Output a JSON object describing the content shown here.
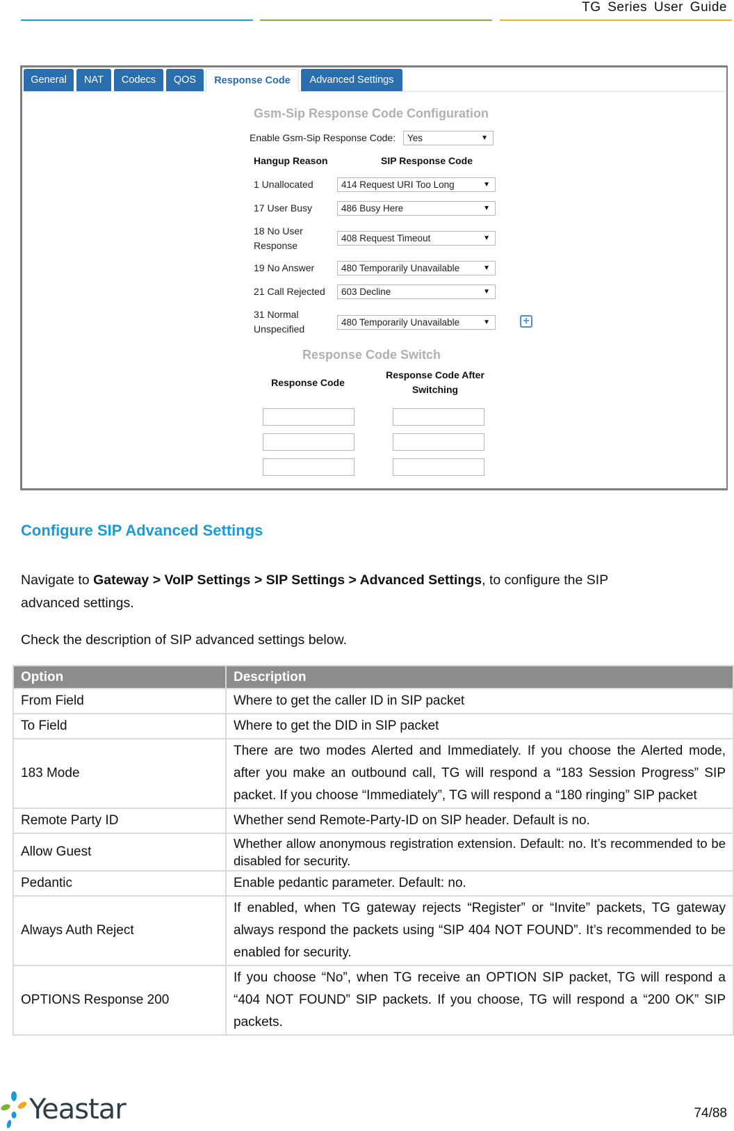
{
  "header": {
    "doc_title": "TG Series User Guide",
    "rule_colors": [
      "#1a9ad6",
      "#7db13a",
      "#f0b323"
    ]
  },
  "screenshot": {
    "tabs": [
      {
        "label": "General",
        "active": false
      },
      {
        "label": "NAT",
        "active": false
      },
      {
        "label": "Codecs",
        "active": false
      },
      {
        "label": "QOS",
        "active": false
      },
      {
        "label": "Response Code",
        "active": true
      },
      {
        "label": "Advanced Settings",
        "active": false
      }
    ],
    "config_title": "Gsm-Sip Response Code Configuration",
    "enable_label": "Enable Gsm-Sip Response Code:",
    "enable_value": "Yes",
    "col_hangup": "Hangup Reason",
    "col_sip": "SIP Response Code",
    "rows": [
      {
        "reason": "1 Unallocated",
        "code": "414 Request URI Too Long"
      },
      {
        "reason": "17 User Busy",
        "code": "486 Busy Here"
      },
      {
        "reason_line1": "18 No User",
        "reason_line2": "Response",
        "code": "408 Request Timeout"
      },
      {
        "reason": "19 No Answer",
        "code": "480 Temporarily Unavailable"
      },
      {
        "reason": "21 Call Rejected",
        "code": "603 Decline"
      },
      {
        "reason_line1": "31 Normal",
        "reason_line2": "Unspecified",
        "code": "480 Temporarily Unavailable"
      }
    ],
    "add_icon": "plus-square-icon",
    "switch_title": "Response Code Switch",
    "switch_col1": "Response Code",
    "switch_col2_line1": "Response Code After",
    "switch_col2_line2": "Switching",
    "switch_inputs": [
      {
        "from": "",
        "to": ""
      },
      {
        "from": "",
        "to": ""
      },
      {
        "from": "",
        "to": ""
      }
    ],
    "arrow_glyph": "▼",
    "accent": "#2a6ead"
  },
  "section": {
    "heading": "Configure SIP Advanced Settings",
    "nav_prefix": "Navigate to ",
    "nav_path": [
      "Gateway",
      "VoIP Settings",
      "SIP Settings",
      "Advanced Settings"
    ],
    "nav_sep": " > ",
    "nav_suffix": ", to configure the SIP",
    "nav_line2": "advanced settings.",
    "check_text": "Check the description of SIP advanced settings below."
  },
  "table": {
    "headers": [
      "Option",
      "Description"
    ],
    "rows": [
      {
        "option": "From Field",
        "description": "Where to get the caller ID in SIP packet"
      },
      {
        "option": "To Field",
        "description": "Where to get the DID in SIP packet"
      },
      {
        "option": "183 Mode",
        "description": "There are two modes Alerted and Immediately. If you choose the Alerted mode, after you make an outbound call, TG will respond a “183 Session Progress” SIP packet. If you choose “Immediately”, TG will respond a “180 ringing” SIP packet"
      },
      {
        "option": "Remote Party ID",
        "description": "Whether send Remote-Party-ID on SIP header. Default is no."
      },
      {
        "option": "Allow Guest",
        "description": "Whether allow anonymous registration extension. Default: no. It’s recommended to be disabled for security."
      },
      {
        "option": "Pedantic",
        "description": "Enable pedantic parameter. Default: no."
      },
      {
        "option": "Always Auth Reject",
        "description": "If enabled, when TG gateway rejects “Register” or “Invite” packets, TG gateway always respond the packets using “SIP 404 NOT FOUND”. It’s recommended to be enabled for security."
      },
      {
        "option": "OPTIONS Response 200",
        "description": "If you choose “No”, when TG receive an OPTION SIP packet, TG will respond a “404 NOT FOUND” SIP packets. If you choose, TG will respond a “200 OK” SIP packets."
      }
    ],
    "header_bg": "#8c8c8c"
  },
  "footer": {
    "logo_text": "Yeastar",
    "page": "74/88",
    "logo_colors": [
      "#1a9ad6",
      "#7db13a",
      "#f0a81e"
    ]
  }
}
